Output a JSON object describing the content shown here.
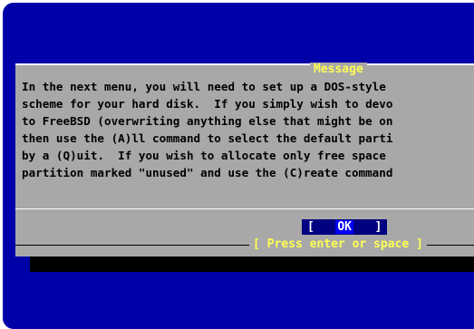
{
  "dialog": {
    "title": "Message",
    "lines": [
      "In the next menu, you will need to set up a DOS-style",
      "scheme for your hard disk.  If you simply wish to devo",
      "to FreeBSD (overwriting anything else that might be on",
      "then use the (A)ll command to select the default parti",
      "by a (Q)uit.  If you wish to allocate only free space",
      "partition marked \"unused\" and use the (C)reate command"
    ],
    "ok_label": "OK",
    "ok_bracket_left": "[",
    "ok_bracket_right": "]",
    "hint": "[ Press enter or space ]"
  },
  "colors": {
    "background": "#0000a8",
    "dialog": "#a8a8a8",
    "title": "#ffff54",
    "button": "#000080"
  }
}
